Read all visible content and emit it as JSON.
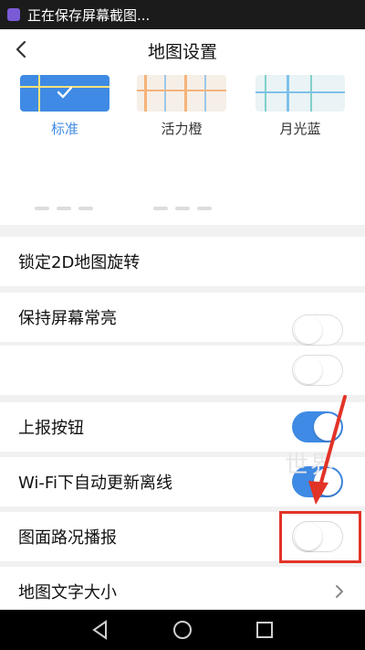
{
  "status_bar": {
    "text": "正在保存屏幕截图..."
  },
  "header": {
    "title": "地图设置"
  },
  "map_styles": [
    {
      "label": "标准",
      "selected": true
    },
    {
      "label": "活力橙",
      "selected": false
    },
    {
      "label": "月光蓝",
      "selected": false
    }
  ],
  "settings": [
    {
      "label": "锁定2D地图旋转"
    },
    {
      "label": "保持屏幕常亮"
    },
    {
      "label": ""
    },
    {
      "label": "上报按钮",
      "toggle": "on"
    },
    {
      "label": "Wi-Fi下自动更新离线",
      "toggle": "on"
    },
    {
      "label": "图面路况播报",
      "toggle": "off"
    },
    {
      "label": "地图文字大小"
    }
  ],
  "watermark": "世界",
  "colors": {
    "accent": "#3f8ae4",
    "highlight": "#e23327"
  }
}
